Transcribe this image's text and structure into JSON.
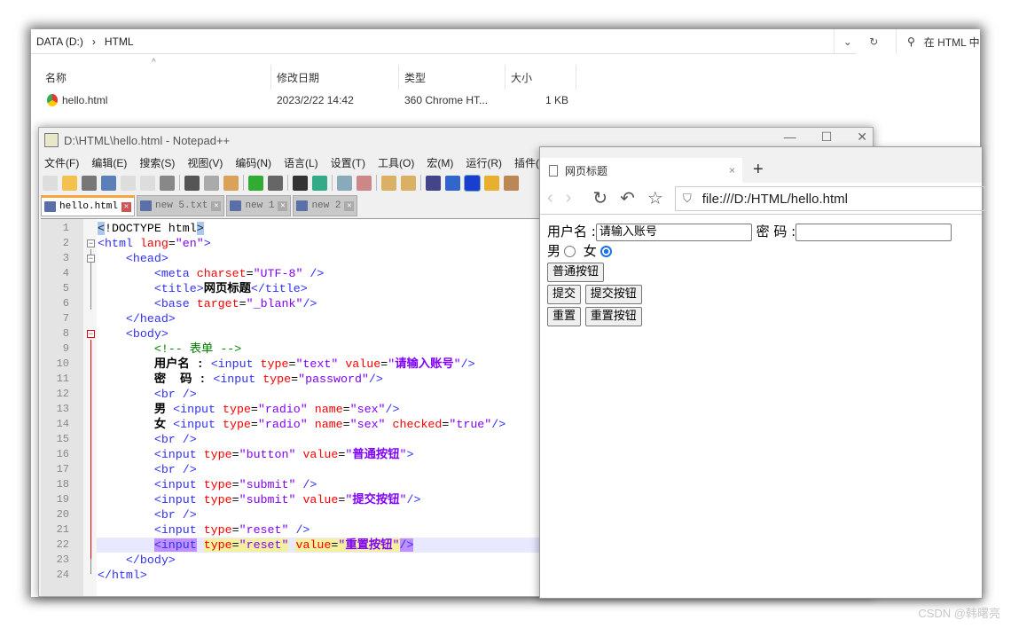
{
  "explorer": {
    "breadcrumb": [
      "DATA (D:)",
      "HTML"
    ],
    "search_placeholder": "在 HTML 中",
    "columns": [
      "名称",
      "修改日期",
      "类型",
      "大小"
    ],
    "files": [
      {
        "name": "hello.html",
        "modified": "2023/2/22 14:42",
        "type": "360 Chrome HT...",
        "size": "1 KB"
      }
    ]
  },
  "notepad": {
    "title": "D:\\HTML\\hello.html - Notepad++",
    "menu": [
      "文件(F)",
      "编辑(E)",
      "搜索(S)",
      "视图(V)",
      "编码(N)",
      "语言(L)",
      "设置(T)",
      "工具(O)",
      "宏(M)",
      "运行(R)",
      "插件("
    ],
    "tabs": [
      {
        "label": "hello.html",
        "active": true
      },
      {
        "label": "new 5.txt"
      },
      {
        "label": "new 1"
      },
      {
        "label": "new 2"
      }
    ],
    "current_line": 22,
    "lines": [
      [
        [
          "hb",
          "<"
        ],
        [
          "p",
          "!DOCTYPE html"
        ],
        [
          "hb",
          ">"
        ]
      ],
      [
        [
          "t",
          "<html "
        ],
        [
          "a",
          "lang"
        ],
        [
          "p",
          "="
        ],
        [
          "v",
          "\"en\""
        ],
        [
          "t",
          ">"
        ]
      ],
      [
        [
          "p",
          "    "
        ],
        [
          "t",
          "<head>"
        ]
      ],
      [
        [
          "p",
          "        "
        ],
        [
          "t",
          "<meta "
        ],
        [
          "a",
          "charset"
        ],
        [
          "p",
          "="
        ],
        [
          "v",
          "\"UTF-8\""
        ],
        [
          "t",
          " />"
        ]
      ],
      [
        [
          "p",
          "        "
        ],
        [
          "t",
          "<title>"
        ],
        [
          "b",
          "网页标题"
        ],
        [
          "t",
          "</title>"
        ]
      ],
      [
        [
          "p",
          "        "
        ],
        [
          "t",
          "<base "
        ],
        [
          "a",
          "target"
        ],
        [
          "p",
          "="
        ],
        [
          "v",
          "\"_blank\""
        ],
        [
          "t",
          "/>"
        ]
      ],
      [
        [
          "p",
          "    "
        ],
        [
          "t",
          "</head>"
        ]
      ],
      [
        [
          "p",
          "    "
        ],
        [
          "t",
          "<body>"
        ]
      ],
      [
        [
          "p",
          "        "
        ],
        [
          "c",
          "<!-- 表单 -->"
        ]
      ],
      [
        [
          "p",
          "        "
        ],
        [
          "b",
          "用户名 : "
        ],
        [
          "t",
          "<input "
        ],
        [
          "a",
          "type"
        ],
        [
          "p",
          "="
        ],
        [
          "v",
          "\"text\" "
        ],
        [
          "a",
          "value"
        ],
        [
          "p",
          "="
        ],
        [
          "v",
          "\""
        ],
        [
          "vb",
          "请输入账号"
        ],
        [
          "v",
          "\""
        ],
        [
          "t",
          "/>"
        ]
      ],
      [
        [
          "p",
          "        "
        ],
        [
          "b",
          "密  码 : "
        ],
        [
          "t",
          "<input "
        ],
        [
          "a",
          "type"
        ],
        [
          "p",
          "="
        ],
        [
          "v",
          "\"password\""
        ],
        [
          "t",
          "/>"
        ]
      ],
      [
        [
          "p",
          "        "
        ],
        [
          "t",
          "<br />"
        ]
      ],
      [
        [
          "p",
          "        "
        ],
        [
          "b",
          "男 "
        ],
        [
          "t",
          "<input "
        ],
        [
          "a",
          "type"
        ],
        [
          "p",
          "="
        ],
        [
          "v",
          "\"radio\" "
        ],
        [
          "a",
          "name"
        ],
        [
          "p",
          "="
        ],
        [
          "v",
          "\"sex\""
        ],
        [
          "t",
          "/>"
        ]
      ],
      [
        [
          "p",
          "        "
        ],
        [
          "b",
          "女 "
        ],
        [
          "t",
          "<input "
        ],
        [
          "a",
          "type"
        ],
        [
          "p",
          "="
        ],
        [
          "v",
          "\"radio\" "
        ],
        [
          "a",
          "name"
        ],
        [
          "p",
          "="
        ],
        [
          "v",
          "\"sex\" "
        ],
        [
          "a",
          "checked"
        ],
        [
          "p",
          "="
        ],
        [
          "v",
          "\"true\""
        ],
        [
          "t",
          "/>"
        ]
      ],
      [
        [
          "p",
          "        "
        ],
        [
          "t",
          "<br />"
        ]
      ],
      [
        [
          "p",
          "        "
        ],
        [
          "t",
          "<input "
        ],
        [
          "a",
          "type"
        ],
        [
          "p",
          "="
        ],
        [
          "v",
          "\"button\" "
        ],
        [
          "a",
          "value"
        ],
        [
          "p",
          "="
        ],
        [
          "v",
          "\""
        ],
        [
          "vb",
          "普通按钮"
        ],
        [
          "v",
          "\""
        ],
        [
          "t",
          ">"
        ]
      ],
      [
        [
          "p",
          "        "
        ],
        [
          "t",
          "<br />"
        ]
      ],
      [
        [
          "p",
          "        "
        ],
        [
          "t",
          "<input "
        ],
        [
          "a",
          "type"
        ],
        [
          "p",
          "="
        ],
        [
          "v",
          "\"submit\""
        ],
        [
          "t",
          " />"
        ]
      ],
      [
        [
          "p",
          "        "
        ],
        [
          "t",
          "<input "
        ],
        [
          "a",
          "type"
        ],
        [
          "p",
          "="
        ],
        [
          "v",
          "\"submit\" "
        ],
        [
          "a",
          "value"
        ],
        [
          "p",
          "="
        ],
        [
          "v",
          "\""
        ],
        [
          "vb",
          "提交按钮"
        ],
        [
          "v",
          "\""
        ],
        [
          "t",
          "/>"
        ]
      ],
      [
        [
          "p",
          "        "
        ],
        [
          "t",
          "<br />"
        ]
      ],
      [
        [
          "p",
          "        "
        ],
        [
          "t",
          "<input "
        ],
        [
          "a",
          "type"
        ],
        [
          "p",
          "="
        ],
        [
          "v",
          "\"reset\""
        ],
        [
          "t",
          " />"
        ]
      ],
      [
        [
          "p",
          "        "
        ],
        [
          "t ht",
          "<input"
        ],
        [
          "p",
          " "
        ],
        [
          "a ha",
          "type"
        ],
        [
          "p ha",
          "="
        ],
        [
          "v ha",
          "\"reset\""
        ],
        [
          "p",
          " "
        ],
        [
          "a ha",
          "value"
        ],
        [
          "p ha",
          "="
        ],
        [
          "v ha",
          "\""
        ],
        [
          "vb ha",
          "重置按钮"
        ],
        [
          "v ha",
          "\""
        ],
        [
          "t ht",
          "/>"
        ]
      ],
      [
        [
          "p",
          "    "
        ],
        [
          "t",
          "</body>"
        ]
      ],
      [
        [
          "t",
          "</html>"
        ]
      ]
    ]
  },
  "browser": {
    "tab_title": "网页标题",
    "new_tab": "+",
    "url": "file:///D:/HTML/hello.html",
    "form": {
      "username_label": "用户名 :",
      "username_value": "请输入账号",
      "password_label": "密 码 :",
      "male_label": "男",
      "female_label": "女",
      "female_checked": true,
      "button_label": "普通按钮",
      "submit_default": "提交",
      "submit_label": "提交按钮",
      "reset_default": "重置",
      "reset_label": "重置按钮"
    }
  },
  "watermark": "CSDN @韩曙亮"
}
